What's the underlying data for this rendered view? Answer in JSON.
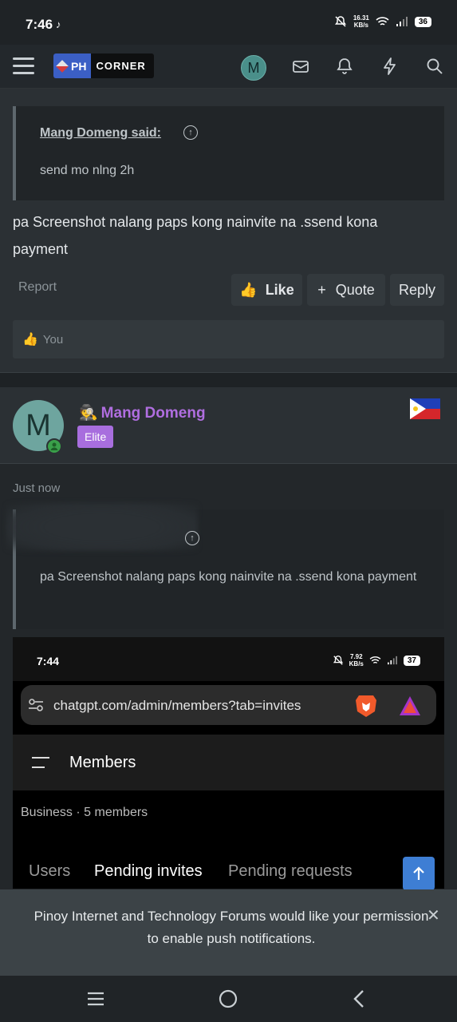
{
  "status_bar": {
    "time": "7:46",
    "speed_top": "16.31",
    "speed_bottom": "KB/s",
    "battery": "36"
  },
  "topnav": {
    "logo_ph": "PH",
    "logo_corner": "CORNER",
    "avatar_initial": "M"
  },
  "post": {
    "quote_author": "Mang Domeng said:",
    "quote_text": "send mo nlng 2h",
    "body": "pa Screenshot nalang paps kong nainvite na .ssend kona payment",
    "report_label": "Report",
    "like_label": "Like",
    "quote_label": "Quote",
    "reply_label": "Reply",
    "reaction_user": "You"
  },
  "next_post": {
    "avatar_initial": "M",
    "username": "Mang Domeng",
    "badge": "Elite",
    "timestamp": "Just now",
    "quote_text": "pa Screenshot nalang paps kong nainvite na .ssend kona payment"
  },
  "screenshot": {
    "time": "7:44",
    "speed_top": "7.92",
    "speed_bottom": "KB/s",
    "battery": "37",
    "url": "chatgpt.com/admin/members?tab=invites",
    "title": "Members",
    "subtitle": "Business · 5 members",
    "tabs": [
      "Users",
      "Pending invites",
      "Pending requests"
    ]
  },
  "toast": {
    "text": "Pinoy Internet and Technology Forums would like your permission to enable push notifications."
  },
  "colors": {
    "accent": "#3e7ed4",
    "username": "#b06ee0",
    "badge": "#a86ede",
    "online": "#3aa04a"
  }
}
